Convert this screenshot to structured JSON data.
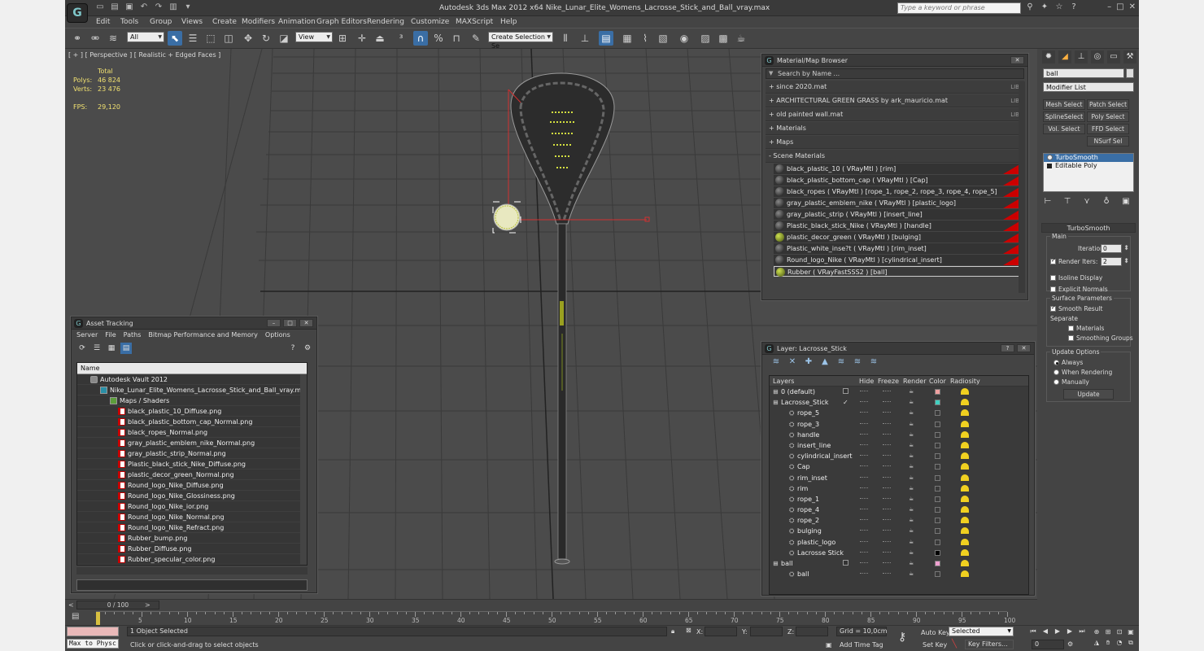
{
  "window": {
    "title": "Autodesk 3ds Max  2012 x64     Nike_Lunar_Elite_Womens_Lacrosse_Stick_and_Ball_vray.max",
    "help_placeholder": "Type a keyword or phrase"
  },
  "menu": [
    "Edit",
    "Tools",
    "Group",
    "Views",
    "Create",
    "Modifiers",
    "Animation",
    "Graph Editors",
    "Rendering",
    "Customize",
    "MAXScript",
    "Help"
  ],
  "toolbar": {
    "selection_filter": "All",
    "ref_coord": "View",
    "named_selection": "Create Selection Se"
  },
  "viewport": {
    "label": "[ + ] [ Perspective ] [ Realistic + Edged Faces ]",
    "stats": {
      "header": "Total",
      "polys_label": "Polys:",
      "polys_value": "46 824",
      "verts_label": "Verts:",
      "verts_value": "23 476",
      "fps_label": "FPS:",
      "fps_value": "29,120"
    }
  },
  "material_browser": {
    "title": "Material/Map Browser",
    "search_placeholder": "Search by Name ...",
    "libraries": [
      {
        "name": "+ since 2020.mat",
        "tag": "LIB"
      },
      {
        "name": "+ ARCHITECTURAL GREEN GRASS by ark_mauricio.mat",
        "tag": "LIB"
      },
      {
        "name": "+ old painted wall.mat",
        "tag": "LIB"
      },
      {
        "name": "+ Materials",
        "tag": ""
      },
      {
        "name": "+ Maps",
        "tag": ""
      },
      {
        "name": "- Scene Materials",
        "tag": ""
      }
    ],
    "scene_materials": [
      "black_plastic_10  ( VRayMtl ) [rim]",
      "black_plastic_bottom_cap  ( VRayMtl ) [Cap]",
      "black_ropes  ( VRayMtl ) [rope_1, rope_2, rope_3, rope_4, rope_5]",
      "gray_plastic_emblem_nike  ( VRayMtl ) [plastic_logo]",
      "gray_plastic_strip  ( VRayMtl ) [insert_line]",
      "Plastic_black_stick_Nike  ( VRayMtl ) [handle]",
      "plastic_decor_green  ( VRayMtl ) [bulging]",
      "Plastic_white_inse?t  ( VRayMtl ) [rim_inset]",
      "Round_logo_Nike  ( VRayMtl ) [cylindrical_insert]",
      "Rubber  ( VRayFastSSS2 ) [ball]"
    ]
  },
  "asset_tracking": {
    "title": "Asset Tracking",
    "menu": [
      "Server",
      "File",
      "Paths",
      "Bitmap Performance and Memory",
      "Options"
    ],
    "column_name": "Name",
    "vault": "Autodesk Vault 2012",
    "max_file": "Nike_Lunar_Elite_Womens_Lacrosse_Stick_and_Ball_vray.max",
    "folder": "Maps / Shaders",
    "files": [
      "black_plastic_10_Diffuse.png",
      "black_plastic_bottom_cap_Normal.png",
      "black_ropes_Normal.png",
      "gray_plastic_emblem_nike_Normal.png",
      "gray_plastic_strip_Normal.png",
      "Plastic_black_stick_Nike_Diffuse.png",
      "plastic_decor_green_Normal.png",
      "Round_logo_Nike_Diffuse.png",
      "Round_logo_Nike_Glossiness.png",
      "Round_logo_Nike_ior.png",
      "Round_logo_Nike_Normal.png",
      "Round_logo_Nike_Refract.png",
      "Rubber_bump.png",
      "Rubber_Diffuse.png",
      "Rubber_specular_color.png"
    ]
  },
  "layer_panel": {
    "title": "Layer: Lacrosse_Stick",
    "columns": [
      "Layers",
      "Hide",
      "Freeze",
      "Render",
      "Color",
      "Radiosity"
    ],
    "rows": [
      {
        "name": "0 (default)",
        "level": 1,
        "color": "#f0a0a0",
        "box": true
      },
      {
        "name": "Lacrosse_Stick",
        "level": 1,
        "color": "#40d0c0",
        "check": true
      },
      {
        "name": "rope_5",
        "level": 2,
        "color": ""
      },
      {
        "name": "rope_3",
        "level": 2,
        "color": ""
      },
      {
        "name": "handle",
        "level": 2,
        "color": ""
      },
      {
        "name": "insert_line",
        "level": 2,
        "color": ""
      },
      {
        "name": "cylindrical_insert",
        "level": 2,
        "color": ""
      },
      {
        "name": "Cap",
        "level": 2,
        "color": ""
      },
      {
        "name": "rim_inset",
        "level": 2,
        "color": ""
      },
      {
        "name": "rim",
        "level": 2,
        "color": ""
      },
      {
        "name": "rope_1",
        "level": 2,
        "color": ""
      },
      {
        "name": "rope_4",
        "level": 2,
        "color": ""
      },
      {
        "name": "rope_2",
        "level": 2,
        "color": ""
      },
      {
        "name": "bulging",
        "level": 2,
        "color": ""
      },
      {
        "name": "plastic_logo",
        "level": 2,
        "color": ""
      },
      {
        "name": "Lacrosse Stick",
        "level": 2,
        "color": "#000000"
      },
      {
        "name": "ball",
        "level": 1,
        "color": "#f0a0d0",
        "box": true
      },
      {
        "name": "ball",
        "level": 2,
        "color": ""
      }
    ]
  },
  "command_panel": {
    "name_field": "ball",
    "modifier_list": "Modifier List",
    "buttons": [
      "Mesh Select",
      "Patch Select",
      "SplineSelect",
      "Poly Select",
      "Vol. Select",
      "FFD Select",
      "NSurf Sel"
    ],
    "stack": [
      "TurboSmooth",
      "Editable Poly"
    ],
    "rollout": "TurboSmooth",
    "main_group": "Main",
    "iterations_label": "Iterations:",
    "iterations_value": "0",
    "render_iters_label": "Render Iters:",
    "render_iters_value": "2",
    "isoline": "Isoline Display",
    "explicit": "Explicit Normals",
    "surface_group": "Surface Parameters",
    "smooth_result": "Smooth Result",
    "separate": "Separate",
    "materials": "Materials",
    "smoothing_groups": "Smoothing Groups",
    "update_group": "Update Options",
    "always": "Always",
    "when_rendering": "When Rendering",
    "manually": "Manually",
    "update_btn": "Update"
  },
  "timeline": {
    "frame": "0 / 100",
    "ticks": [
      "5",
      "10",
      "15",
      "20",
      "25",
      "30",
      "35",
      "40",
      "45",
      "50",
      "55",
      "60",
      "65",
      "70",
      "75",
      "80",
      "85",
      "90",
      "95",
      "100"
    ]
  },
  "status": {
    "maxscript": "Max to Physc",
    "selected": "1 Object Selected",
    "prompt": "Click or click-and-drag to select objects",
    "x_label": "X:",
    "y_label": "Y:",
    "z_label": "Z:",
    "grid": "Grid = 10,0cm",
    "add_time_tag": "Add Time Tag",
    "auto_key": "Auto Key",
    "set_key": "Set Key",
    "selected_sel": "Selected",
    "key_filters": "Key Filters...",
    "frame_value": "0"
  }
}
